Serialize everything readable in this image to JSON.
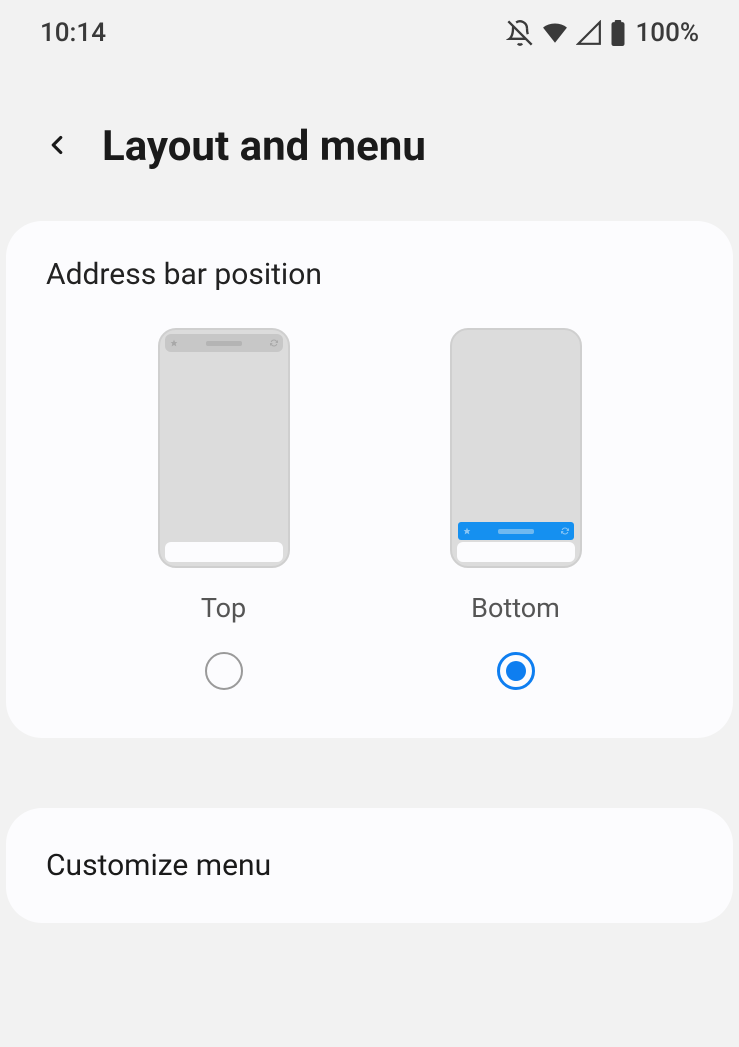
{
  "statusBar": {
    "time": "10:14",
    "batteryPercent": "100%"
  },
  "header": {
    "title": "Layout and menu"
  },
  "addressBarSection": {
    "label": "Address bar position",
    "options": {
      "top": {
        "label": "Top",
        "selected": false
      },
      "bottom": {
        "label": "Bottom",
        "selected": true
      }
    }
  },
  "customizeMenu": {
    "label": "Customize menu"
  }
}
